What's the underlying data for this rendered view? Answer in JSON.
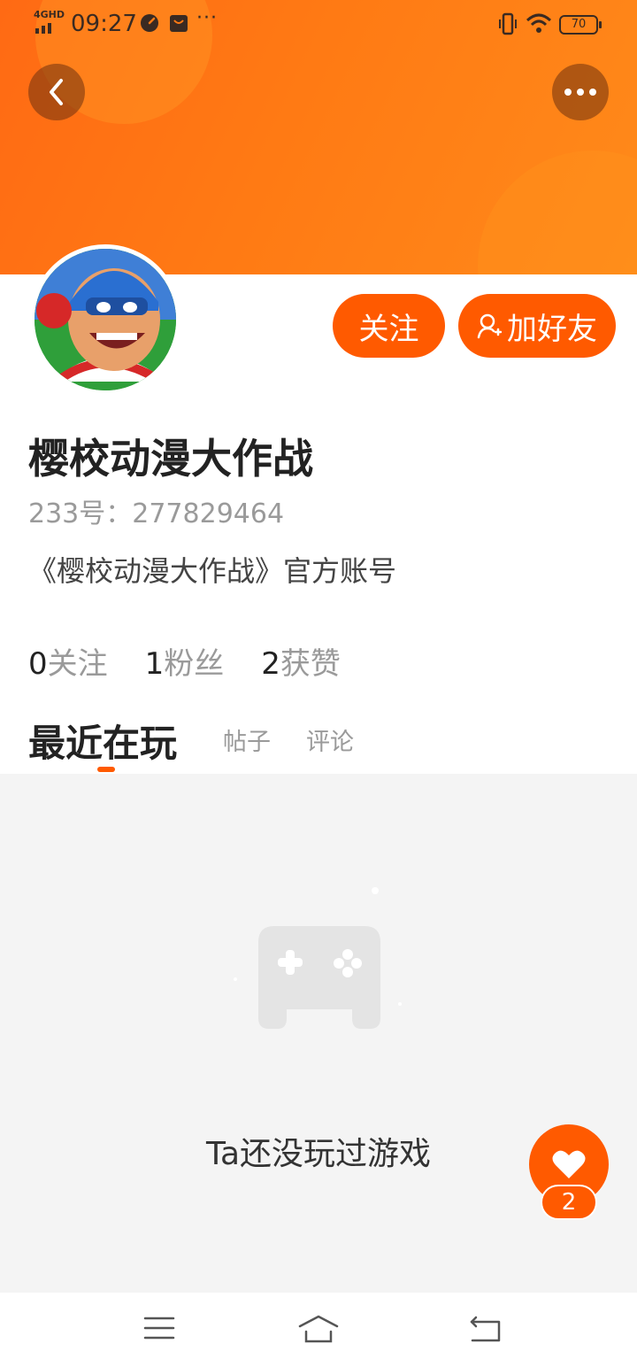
{
  "status_bar": {
    "network": "4GHD",
    "time": "09:27",
    "more_dots": "···",
    "battery": "70",
    "icons": [
      "speedometer-icon",
      "bag-icon",
      "vibrate-icon",
      "wifi-icon",
      "battery-icon"
    ]
  },
  "header": {
    "back_icon": "chevron-left-icon",
    "more_icon": "more-dots-icon",
    "colors": {
      "gradient_start": "#ff6a14",
      "gradient_end": "#ff8a1a"
    }
  },
  "profile": {
    "name": "樱校动漫大作战",
    "account_id": "233号：277829464",
    "bio": "《樱校动漫大作战》官方账号",
    "follow_label": "关注",
    "add_friend_label": "加好友",
    "add_friend_icon": "user-plus-icon"
  },
  "stats": [
    {
      "num": "0",
      "label": "关注"
    },
    {
      "num": "1",
      "label": "粉丝"
    },
    {
      "num": "2",
      "label": "获赞"
    }
  ],
  "tabs": {
    "active": "最近在玩",
    "posts": "帖子",
    "comments": "评论"
  },
  "empty_state": {
    "icon": "gamepad-icon",
    "text": "Ta还没玩过游戏"
  },
  "like_fab": {
    "icon": "heart-icon",
    "count": "2"
  },
  "nav_bar": {
    "icons": [
      "menu-icon",
      "home-icon",
      "back-icon"
    ]
  },
  "accent_color": "#ff5a00"
}
